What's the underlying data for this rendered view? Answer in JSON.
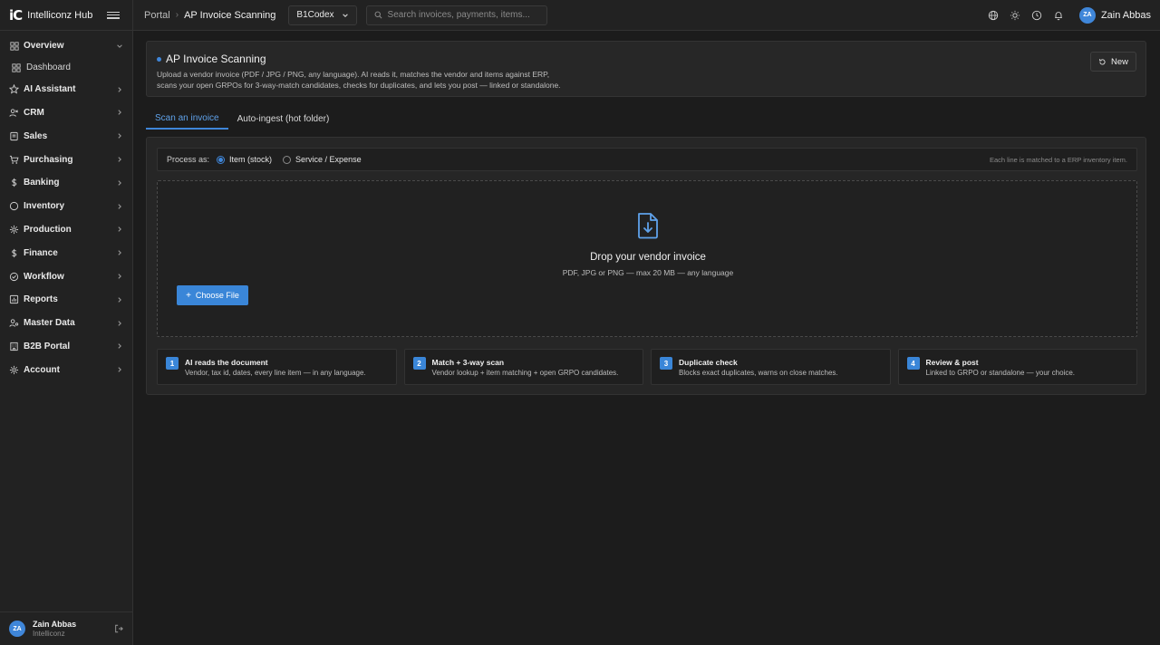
{
  "brand": {
    "logo": "iC",
    "name": "Intelliconz Hub"
  },
  "breadcrumb": {
    "root": "Portal",
    "current": "AP Invoice Scanning"
  },
  "company": {
    "selected": "B1Codex"
  },
  "search": {
    "placeholder": "Search invoices, payments, items..."
  },
  "user": {
    "initials": "ZA",
    "name": "Zain Abbas",
    "org": "Intelliconz"
  },
  "sidebar": {
    "overview": "Overview",
    "dashboard": "Dashboard",
    "items": [
      {
        "label": "AI Assistant",
        "icon": "star-icon"
      },
      {
        "label": "CRM",
        "icon": "users-icon"
      },
      {
        "label": "Sales",
        "icon": "document-icon"
      },
      {
        "label": "Purchasing",
        "icon": "cart-icon"
      },
      {
        "label": "Banking",
        "icon": "dollar-icon"
      },
      {
        "label": "Inventory",
        "icon": "box-icon"
      },
      {
        "label": "Production",
        "icon": "gear-icon"
      },
      {
        "label": "Finance",
        "icon": "dollar-icon"
      },
      {
        "label": "Workflow",
        "icon": "check-circle-icon"
      },
      {
        "label": "Reports",
        "icon": "report-icon"
      },
      {
        "label": "Master Data",
        "icon": "user-settings-icon"
      },
      {
        "label": "B2B Portal",
        "icon": "building-icon"
      },
      {
        "label": "Account",
        "icon": "settings-icon"
      }
    ]
  },
  "header": {
    "title": "AP Invoice Scanning",
    "description": "Upload a vendor invoice (PDF / JPG / PNG, any language). AI reads it, matches the vendor and items against ERP, scans your open GRPOs for 3-way-match candidates, checks for duplicates, and lets you post — linked or standalone.",
    "new_label": "New"
  },
  "tabs": [
    {
      "label": "Scan an invoice",
      "active": true
    },
    {
      "label": "Auto-ingest (hot folder)",
      "active": false
    }
  ],
  "process": {
    "label": "Process as:",
    "options": [
      {
        "label": "Item (stock)",
        "selected": true
      },
      {
        "label": "Service / Expense",
        "selected": false
      }
    ],
    "hint": "Each line is matched to a ERP inventory item."
  },
  "dropzone": {
    "title": "Drop your vendor invoice",
    "subtitle": "PDF, JPG or PNG — max 20 MB — any language",
    "button": "Choose File"
  },
  "steps": [
    {
      "num": "1",
      "title": "AI reads the document",
      "desc": "Vendor, tax id, dates, every line item — in any language."
    },
    {
      "num": "2",
      "title": "Match + 3-way scan",
      "desc": "Vendor lookup + item matching + open GRPO candidates."
    },
    {
      "num": "3",
      "title": "Duplicate check",
      "desc": "Blocks exact duplicates, warns on close matches."
    },
    {
      "num": "4",
      "title": "Review & post",
      "desc": "Linked to GRPO or standalone — your choice."
    }
  ],
  "colors": {
    "accent": "#3f86d9",
    "background": "#1c1c1c",
    "panel": "#262626"
  }
}
